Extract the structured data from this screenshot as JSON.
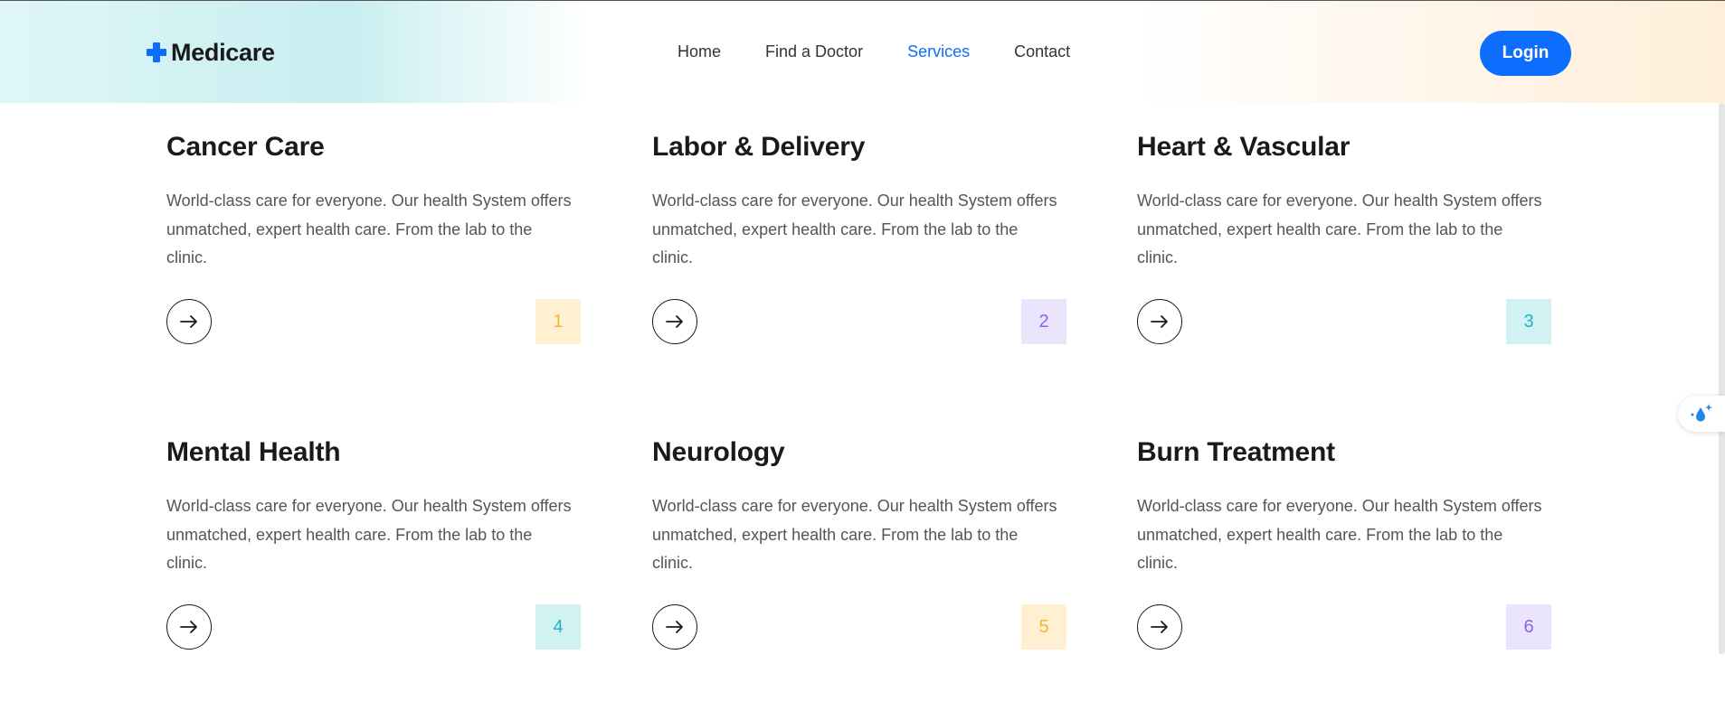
{
  "header": {
    "brand": "Medicare",
    "nav": [
      {
        "label": "Home"
      },
      {
        "label": "Find a Doctor"
      },
      {
        "label": "Services",
        "active": true
      },
      {
        "label": "Contact"
      }
    ],
    "login_label": "Login"
  },
  "colors": {
    "accent": "#0d6efd",
    "badge_yellow_bg": "#fff0d1",
    "badge_yellow_fg": "#f5b731",
    "badge_purple_bg": "#ebe4fd",
    "badge_purple_fg": "#8b63e6",
    "badge_teal_bg": "#d2f1f3",
    "badge_teal_fg": "#1fb6bf"
  },
  "services": [
    {
      "title": "Cancer Care",
      "description": "World-class care for everyone. Our health System offers unmatched, expert health care. From the lab to the clinic.",
      "number": "1",
      "badge": "yellow"
    },
    {
      "title": "Labor & Delivery",
      "description": "World-class care for everyone. Our health System offers unmatched, expert health care. From the lab to the clinic.",
      "number": "2",
      "badge": "purple"
    },
    {
      "title": "Heart & Vascular",
      "description": "World-class care for everyone. Our health System offers unmatched, expert health care. From the lab to the clinic.",
      "number": "3",
      "badge": "teal"
    },
    {
      "title": "Mental Health",
      "description": "World-class care for everyone. Our health System offers unmatched, expert health care. From the lab to the clinic.",
      "number": "4",
      "badge": "teal"
    },
    {
      "title": "Neurology",
      "description": "World-class care for everyone. Our health System offers unmatched, expert health care. From the lab to the clinic.",
      "number": "5",
      "badge": "yellow"
    },
    {
      "title": "Burn Treatment",
      "description": "World-class care for everyone. Our health System offers unmatched, expert health care. From the lab to the clinic.",
      "number": "6",
      "badge": "purple"
    }
  ],
  "icons": {
    "card_button": "arrow-right-icon",
    "widget": "water-drop-sparkle-icon"
  }
}
